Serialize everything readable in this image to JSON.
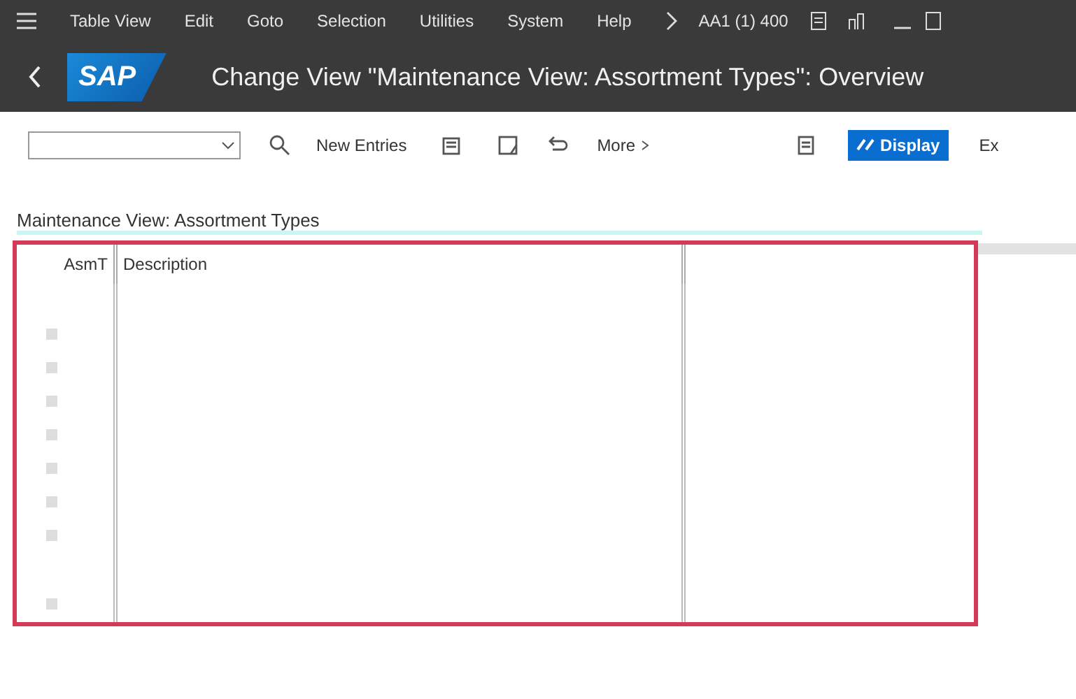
{
  "menu_bar": {
    "items": [
      "Table View",
      "Edit",
      "Goto",
      "Selection",
      "Utilities",
      "System",
      "Help"
    ],
    "system_info": "AA1 (1) 400"
  },
  "title_bar": {
    "logo": "SAP",
    "title": "Change View \"Maintenance View: Assortment Types\": Overview"
  },
  "toolbar": {
    "buttons": [
      "New Entries",
      "More"
    ],
    "display_button": "Display",
    "cut_button": "Ex"
  },
  "section": {
    "title": "Maintenance View: Assortment Types"
  },
  "table": {
    "columns": [
      "AsmT",
      "Description"
    ]
  }
}
